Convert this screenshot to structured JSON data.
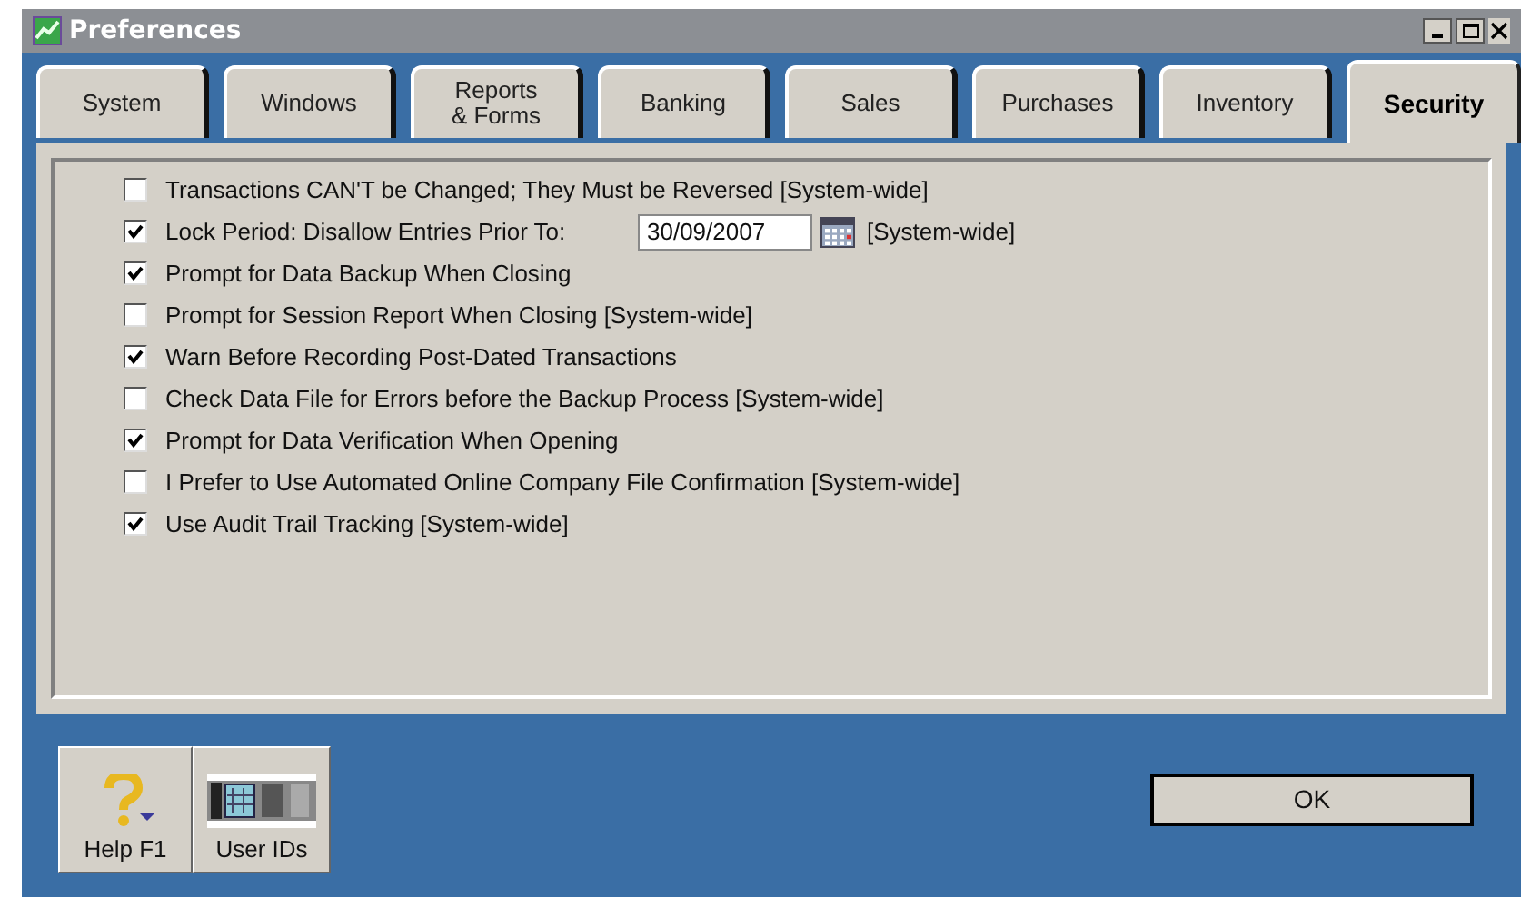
{
  "window": {
    "title": "Preferences"
  },
  "tabs": [
    {
      "label": "System",
      "selected": false
    },
    {
      "label": "Windows",
      "selected": false
    },
    {
      "label": "Reports\n& Forms",
      "selected": false
    },
    {
      "label": "Banking",
      "selected": false
    },
    {
      "label": "Sales",
      "selected": false
    },
    {
      "label": "Purchases",
      "selected": false
    },
    {
      "label": "Inventory",
      "selected": false
    },
    {
      "label": "Security",
      "selected": true
    }
  ],
  "options": [
    {
      "kind": "checkbox",
      "label": "Transactions CAN'T be Changed; They Must be Reversed [System-wide]",
      "checked": false
    },
    {
      "kind": "date",
      "label": "Lock Period: Disallow Entries Prior To:",
      "checked": true,
      "value": "30/09/2007",
      "suffix": "[System-wide]"
    },
    {
      "kind": "checkbox",
      "label": "Prompt for Data Backup When Closing",
      "checked": true
    },
    {
      "kind": "checkbox",
      "label": "Prompt for Session Report When Closing [System-wide]",
      "checked": false
    },
    {
      "kind": "checkbox",
      "label": "Warn Before Recording Post-Dated Transactions",
      "checked": true
    },
    {
      "kind": "checkbox",
      "label": "Check Data File for Errors before the Backup Process [System-wide]",
      "checked": false
    },
    {
      "kind": "checkbox",
      "label": "Prompt for Data Verification When Opening",
      "checked": true
    },
    {
      "kind": "checkbox",
      "label": "I Prefer to Use Automated Online Company File Confirmation [System-wide]",
      "checked": false
    },
    {
      "kind": "checkbox",
      "label": "Use Audit Trail Tracking [System-wide]",
      "checked": true
    }
  ],
  "toolbar": [
    {
      "kind": "help",
      "label": "Help F1"
    },
    {
      "kind": "users",
      "label": "User IDs"
    }
  ],
  "buttons": [
    "OK"
  ]
}
